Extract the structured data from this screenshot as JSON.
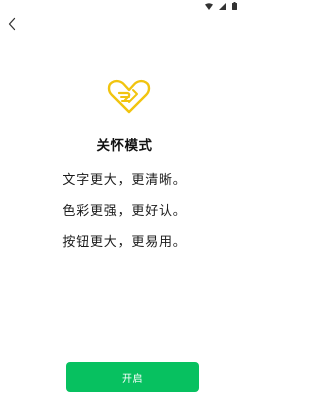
{
  "status_bar": {
    "icons": [
      "wifi-icon",
      "signal-icon",
      "battery-icon"
    ]
  },
  "nav": {
    "back_icon": "chevron-left-icon"
  },
  "main": {
    "icon": "care-mode-icon",
    "title": "关怀模式",
    "descriptions": [
      "文字更大，更清晰。",
      "色彩更强，更好认。",
      "按钮更大，更易用。"
    ]
  },
  "actions": {
    "enable_label": "开启"
  },
  "colors": {
    "accent": "#07c160",
    "icon_yellow": "#f1c40f",
    "text": "#111111"
  }
}
